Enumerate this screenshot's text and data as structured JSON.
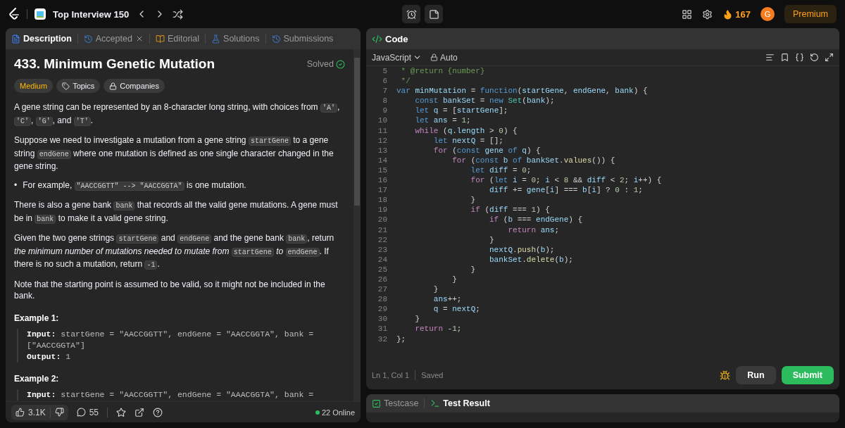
{
  "header": {
    "list_title": "Top Interview 150",
    "streak": "167",
    "avatar": "G",
    "premium": "Premium"
  },
  "description_panel": {
    "tabs": [
      {
        "label": "Description",
        "selected": true,
        "kind": "description",
        "closable": false
      },
      {
        "label": "Accepted",
        "selected": false,
        "kind": "accepted",
        "closable": true
      },
      {
        "label": "Editorial",
        "selected": false,
        "kind": "editorial",
        "closable": false
      },
      {
        "label": "Solutions",
        "selected": false,
        "kind": "solutions",
        "closable": false
      },
      {
        "label": "Submissions",
        "selected": false,
        "kind": "submissions",
        "closable": false
      }
    ],
    "title": "433. Minimum Genetic Mutation",
    "status": "Solved",
    "tags": [
      {
        "label": "Medium",
        "kind": "difficulty"
      },
      {
        "label": "Topics",
        "kind": "topics"
      },
      {
        "label": "Companies",
        "kind": "companies"
      }
    ],
    "paragraphs": [
      {
        "kind": "text",
        "parts": [
          {
            "kind": "text",
            "text": "A gene string can be represented by an 8-character long string, with choices from "
          },
          {
            "kind": "code",
            "text": "'A'"
          },
          {
            "kind": "text",
            "text": ", "
          },
          {
            "kind": "code",
            "text": "'C'"
          },
          {
            "kind": "text",
            "text": ", "
          },
          {
            "kind": "code",
            "text": "'G'"
          },
          {
            "kind": "text",
            "text": ", and "
          },
          {
            "kind": "code",
            "text": "'T'"
          },
          {
            "kind": "text",
            "text": "."
          }
        ]
      },
      {
        "kind": "text",
        "parts": [
          {
            "kind": "text",
            "text": "Suppose we need to investigate a mutation from a gene string "
          },
          {
            "kind": "code",
            "text": "startGene"
          },
          {
            "kind": "text",
            "text": " to a gene string "
          },
          {
            "kind": "code",
            "text": "endGene"
          },
          {
            "kind": "text",
            "text": " where one mutation is defined as one single character changed in the gene string."
          }
        ]
      },
      {
        "kind": "bullet",
        "marker": "•",
        "parts": [
          {
            "kind": "text",
            "text": "For example, "
          },
          {
            "kind": "code",
            "text": "\"AACCGGTT\" --> \"AACCGGTA\""
          },
          {
            "kind": "text",
            "text": " is one mutation."
          }
        ]
      },
      {
        "kind": "text",
        "parts": [
          {
            "kind": "text",
            "text": "There is also a gene bank "
          },
          {
            "kind": "code",
            "text": "bank"
          },
          {
            "kind": "text",
            "text": " that records all the valid gene mutations. A gene must be in "
          },
          {
            "kind": "code",
            "text": "bank"
          },
          {
            "kind": "text",
            "text": " to make it a valid gene string."
          }
        ]
      },
      {
        "kind": "text",
        "parts": [
          {
            "kind": "text",
            "text": "Given the two gene strings "
          },
          {
            "kind": "code",
            "text": "startGene"
          },
          {
            "kind": "text",
            "text": " and "
          },
          {
            "kind": "code",
            "text": "endGene"
          },
          {
            "kind": "text",
            "text": " and the gene bank "
          },
          {
            "kind": "code",
            "text": "bank"
          },
          {
            "kind": "text",
            "text": ", return "
          },
          {
            "kind": "italic",
            "text": "the minimum number of mutations needed to mutate from "
          },
          {
            "kind": "code",
            "text": "startGene"
          },
          {
            "kind": "italic",
            "text": " to "
          },
          {
            "kind": "code",
            "text": "endGene"
          },
          {
            "kind": "text",
            "text": ". If there is no such a mutation, return "
          },
          {
            "kind": "code",
            "text": "-1"
          },
          {
            "kind": "text",
            "text": "."
          }
        ]
      },
      {
        "kind": "text",
        "parts": [
          {
            "kind": "text",
            "text": "Note that the starting point is assumed to be valid, so it might not be included in the bank."
          }
        ]
      }
    ],
    "examples": [
      {
        "title": "Example 1:",
        "lines": [
          {
            "label": "Input:",
            "value": "startGene = \"AACCGGTT\", endGene = \"AACCGGTA\", bank = [\"AACCGGTA\"]"
          },
          {
            "label": "Output:",
            "value": "1"
          }
        ]
      },
      {
        "title": "Example 2:",
        "lines": [
          {
            "label": "Input:",
            "value": "startGene = \"AACCGGTT\", endGene = \"AAACGGTA\", bank ="
          }
        ]
      }
    ],
    "likes": "3.1K",
    "comments": "55",
    "online": "22 Online"
  },
  "code_panel": {
    "title": "Code",
    "language": "JavaScript",
    "mode": "Auto",
    "lines": [
      {
        "n": "5",
        "tokens": [
          {
            "kind": "com",
            "text": " * @return {number}"
          }
        ]
      },
      {
        "n": "6",
        "tokens": [
          {
            "kind": "com",
            "text": " */"
          }
        ]
      },
      {
        "n": "7",
        "tokens": [
          {
            "kind": "decl",
            "text": "var"
          },
          {
            "kind": "id",
            "text": " minMutation"
          },
          {
            "kind": "p",
            "text": " = "
          },
          {
            "kind": "decl",
            "text": "function"
          },
          {
            "kind": "p",
            "text": "("
          },
          {
            "kind": "id",
            "text": "startGene"
          },
          {
            "kind": "p",
            "text": ", "
          },
          {
            "kind": "id",
            "text": "endGene"
          },
          {
            "kind": "p",
            "text": ", "
          },
          {
            "kind": "id",
            "text": "bank"
          },
          {
            "kind": "p",
            "text": ") {"
          }
        ]
      },
      {
        "n": "8",
        "tokens": [
          {
            "kind": "decl",
            "text": "    const"
          },
          {
            "kind": "id",
            "text": " bankSet"
          },
          {
            "kind": "p",
            "text": " = "
          },
          {
            "kind": "decl",
            "text": "new"
          },
          {
            "kind": "type",
            "text": " Set"
          },
          {
            "kind": "p",
            "text": "("
          },
          {
            "kind": "id",
            "text": "bank"
          },
          {
            "kind": "p",
            "text": ");"
          }
        ]
      },
      {
        "n": "9",
        "tokens": [
          {
            "kind": "decl",
            "text": "    let"
          },
          {
            "kind": "id",
            "text": " q"
          },
          {
            "kind": "p",
            "text": " = ["
          },
          {
            "kind": "id",
            "text": "startGene"
          },
          {
            "kind": "p",
            "text": "];"
          }
        ]
      },
      {
        "n": "10",
        "tokens": [
          {
            "kind": "decl",
            "text": "    let"
          },
          {
            "kind": "id",
            "text": " ans"
          },
          {
            "kind": "p",
            "text": " = "
          },
          {
            "kind": "num",
            "text": "1"
          },
          {
            "kind": "p",
            "text": ";"
          }
        ]
      },
      {
        "n": "11",
        "tokens": [
          {
            "kind": "ctrl",
            "text": "    while"
          },
          {
            "kind": "p",
            "text": " ("
          },
          {
            "kind": "id",
            "text": "q"
          },
          {
            "kind": "p",
            "text": "."
          },
          {
            "kind": "id",
            "text": "length"
          },
          {
            "kind": "p",
            "text": " > "
          },
          {
            "kind": "num",
            "text": "0"
          },
          {
            "kind": "p",
            "text": ") {"
          }
        ]
      },
      {
        "n": "12",
        "tokens": [
          {
            "kind": "decl",
            "text": "        let"
          },
          {
            "kind": "id",
            "text": " nextQ"
          },
          {
            "kind": "p",
            "text": " = [];"
          }
        ]
      },
      {
        "n": "13",
        "tokens": [
          {
            "kind": "ctrl",
            "text": "        for"
          },
          {
            "kind": "p",
            "text": " ("
          },
          {
            "kind": "decl",
            "text": "const"
          },
          {
            "kind": "id",
            "text": " gene"
          },
          {
            "kind": "decl",
            "text": " of"
          },
          {
            "kind": "id",
            "text": " q"
          },
          {
            "kind": "p",
            "text": ") {"
          }
        ]
      },
      {
        "n": "14",
        "tokens": [
          {
            "kind": "ctrl",
            "text": "            for"
          },
          {
            "kind": "p",
            "text": " ("
          },
          {
            "kind": "decl",
            "text": "const"
          },
          {
            "kind": "id",
            "text": " b"
          },
          {
            "kind": "decl",
            "text": " of"
          },
          {
            "kind": "id",
            "text": " bankSet"
          },
          {
            "kind": "p",
            "text": "."
          },
          {
            "kind": "fn",
            "text": "values"
          },
          {
            "kind": "p",
            "text": "()) {"
          }
        ]
      },
      {
        "n": "15",
        "tokens": [
          {
            "kind": "decl",
            "text": "                let"
          },
          {
            "kind": "id",
            "text": " diff"
          },
          {
            "kind": "p",
            "text": " = "
          },
          {
            "kind": "num",
            "text": "0"
          },
          {
            "kind": "p",
            "text": ";"
          }
        ]
      },
      {
        "n": "16",
        "tokens": [
          {
            "kind": "ctrl",
            "text": "                for"
          },
          {
            "kind": "p",
            "text": " ("
          },
          {
            "kind": "decl",
            "text": "let"
          },
          {
            "kind": "id",
            "text": " i"
          },
          {
            "kind": "p",
            "text": " = "
          },
          {
            "kind": "num",
            "text": "0"
          },
          {
            "kind": "p",
            "text": "; "
          },
          {
            "kind": "id",
            "text": "i"
          },
          {
            "kind": "p",
            "text": " < "
          },
          {
            "kind": "num",
            "text": "8"
          },
          {
            "kind": "p",
            "text": " && "
          },
          {
            "kind": "id",
            "text": "diff"
          },
          {
            "kind": "p",
            "text": " < "
          },
          {
            "kind": "num",
            "text": "2"
          },
          {
            "kind": "p",
            "text": "; "
          },
          {
            "kind": "id",
            "text": "i"
          },
          {
            "kind": "p",
            "text": "++) {"
          }
        ]
      },
      {
        "n": "17",
        "tokens": [
          {
            "kind": "id",
            "text": "                    diff"
          },
          {
            "kind": "p",
            "text": " += "
          },
          {
            "kind": "id",
            "text": "gene"
          },
          {
            "kind": "p",
            "text": "["
          },
          {
            "kind": "id",
            "text": "i"
          },
          {
            "kind": "p",
            "text": "] === "
          },
          {
            "kind": "id",
            "text": "b"
          },
          {
            "kind": "p",
            "text": "["
          },
          {
            "kind": "id",
            "text": "i"
          },
          {
            "kind": "p",
            "text": "] ? "
          },
          {
            "kind": "num",
            "text": "0"
          },
          {
            "kind": "p",
            "text": " : "
          },
          {
            "kind": "num",
            "text": "1"
          },
          {
            "kind": "p",
            "text": ";"
          }
        ]
      },
      {
        "n": "18",
        "tokens": [
          {
            "kind": "p",
            "text": "                }"
          }
        ]
      },
      {
        "n": "19",
        "tokens": [
          {
            "kind": "ctrl",
            "text": "                if"
          },
          {
            "kind": "p",
            "text": " ("
          },
          {
            "kind": "id",
            "text": "diff"
          },
          {
            "kind": "p",
            "text": " === "
          },
          {
            "kind": "num",
            "text": "1"
          },
          {
            "kind": "p",
            "text": ") {"
          }
        ]
      },
      {
        "n": "20",
        "tokens": [
          {
            "kind": "ctrl",
            "text": "                    if"
          },
          {
            "kind": "p",
            "text": " ("
          },
          {
            "kind": "id",
            "text": "b"
          },
          {
            "kind": "p",
            "text": " === "
          },
          {
            "kind": "id",
            "text": "endGene"
          },
          {
            "kind": "p",
            "text": ") {"
          }
        ]
      },
      {
        "n": "21",
        "tokens": [
          {
            "kind": "ctrl",
            "text": "                        return"
          },
          {
            "kind": "id",
            "text": " ans"
          },
          {
            "kind": "p",
            "text": ";"
          }
        ]
      },
      {
        "n": "22",
        "tokens": [
          {
            "kind": "p",
            "text": "                    }"
          }
        ]
      },
      {
        "n": "23",
        "tokens": [
          {
            "kind": "id",
            "text": "                    nextQ"
          },
          {
            "kind": "p",
            "text": "."
          },
          {
            "kind": "fn",
            "text": "push"
          },
          {
            "kind": "p",
            "text": "("
          },
          {
            "kind": "id",
            "text": "b"
          },
          {
            "kind": "p",
            "text": ");"
          }
        ]
      },
      {
        "n": "24",
        "tokens": [
          {
            "kind": "id",
            "text": "                    bankSet"
          },
          {
            "kind": "p",
            "text": "."
          },
          {
            "kind": "fn",
            "text": "delete"
          },
          {
            "kind": "p",
            "text": "("
          },
          {
            "kind": "id",
            "text": "b"
          },
          {
            "kind": "p",
            "text": ");"
          }
        ]
      },
      {
        "n": "25",
        "tokens": [
          {
            "kind": "p",
            "text": "                }"
          }
        ]
      },
      {
        "n": "26",
        "tokens": [
          {
            "kind": "p",
            "text": "            }"
          }
        ]
      },
      {
        "n": "27",
        "tokens": [
          {
            "kind": "p",
            "text": "        }"
          }
        ]
      },
      {
        "n": "28",
        "tokens": [
          {
            "kind": "id",
            "text": "        ans"
          },
          {
            "kind": "p",
            "text": "++;"
          }
        ]
      },
      {
        "n": "29",
        "tokens": [
          {
            "kind": "id",
            "text": "        q"
          },
          {
            "kind": "p",
            "text": " = "
          },
          {
            "kind": "id",
            "text": "nextQ"
          },
          {
            "kind": "p",
            "text": ";"
          }
        ]
      },
      {
        "n": "30",
        "tokens": [
          {
            "kind": "p",
            "text": "    }"
          }
        ]
      },
      {
        "n": "31",
        "tokens": [
          {
            "kind": "ctrl",
            "text": "    return"
          },
          {
            "kind": "p",
            "text": " -"
          },
          {
            "kind": "num",
            "text": "1"
          },
          {
            "kind": "p",
            "text": ";"
          }
        ]
      },
      {
        "n": "32",
        "tokens": [
          {
            "kind": "p",
            "text": "};"
          }
        ]
      }
    ],
    "cursor": "Ln 1, Col 1",
    "save_state": "Saved",
    "run": "Run",
    "submit": "Submit"
  },
  "result_panel": {
    "tabs": [
      {
        "label": "Testcase",
        "selected": false,
        "kind": "testcase"
      },
      {
        "label": "Test Result",
        "selected": true,
        "kind": "result"
      }
    ]
  }
}
